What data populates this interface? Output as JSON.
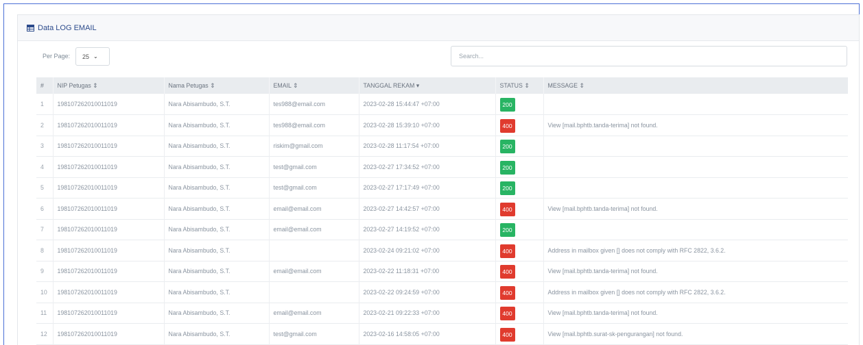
{
  "card": {
    "title": "Data LOG EMAIL",
    "title_icon": "table-icon",
    "accent": "#2b4a8b"
  },
  "controls": {
    "per_page_label": "Per Page:",
    "per_page_value": "25",
    "search_placeholder": "Search..."
  },
  "table": {
    "columns": [
      "#",
      "NIP Petugas ⇕",
      "Nama Petugas ⇕",
      "EMAIL ⇕",
      "TANGGAL REKAM ▾",
      "STATUS ⇕",
      "MESSAGE ⇕"
    ],
    "status_colors": {
      "200": "#28b463",
      "400": "#e03b2e"
    },
    "rows": [
      {
        "no": "1",
        "nip": "198107262010011019",
        "nama": "Nara Abisambudo, S.T.",
        "email": "tes988@email.com",
        "tanggal": "2023-02-28 15:44:47 +07:00",
        "status": "200",
        "message": ""
      },
      {
        "no": "2",
        "nip": "198107262010011019",
        "nama": "Nara Abisambudo, S.T.",
        "email": "tes988@email.com",
        "tanggal": "2023-02-28 15:39:10 +07:00",
        "status": "400",
        "message": "View [mail.bphtb.tanda-terima] not found."
      },
      {
        "no": "3",
        "nip": "198107262010011019",
        "nama": "Nara Abisambudo, S.T.",
        "email": "riskim@gmail.com",
        "tanggal": "2023-02-28 11:17:54 +07:00",
        "status": "200",
        "message": ""
      },
      {
        "no": "4",
        "nip": "198107262010011019",
        "nama": "Nara Abisambudo, S.T.",
        "email": "test@gmail.com",
        "tanggal": "2023-02-27 17:34:52 +07:00",
        "status": "200",
        "message": ""
      },
      {
        "no": "5",
        "nip": "198107262010011019",
        "nama": "Nara Abisambudo, S.T.",
        "email": "test@gmail.com",
        "tanggal": "2023-02-27 17:17:49 +07:00",
        "status": "200",
        "message": ""
      },
      {
        "no": "6",
        "nip": "198107262010011019",
        "nama": "Nara Abisambudo, S.T.",
        "email": "email@email.com",
        "tanggal": "2023-02-27 14:42:57 +07:00",
        "status": "400",
        "message": "View [mail.bphtb.tanda-terima] not found."
      },
      {
        "no": "7",
        "nip": "198107262010011019",
        "nama": "Nara Abisambudo, S.T.",
        "email": "email@email.com",
        "tanggal": "2023-02-27 14:19:52 +07:00",
        "status": "200",
        "message": ""
      },
      {
        "no": "8",
        "nip": "198107262010011019",
        "nama": "Nara Abisambudo, S.T.",
        "email": "",
        "tanggal": "2023-02-24 09:21:02 +07:00",
        "status": "400",
        "message": "Address in mailbox given [] does not comply with RFC 2822, 3.6.2."
      },
      {
        "no": "9",
        "nip": "198107262010011019",
        "nama": "Nara Abisambudo, S.T.",
        "email": "email@email.com",
        "tanggal": "2023-02-22 11:18:31 +07:00",
        "status": "400",
        "message": "View [mail.bphtb.tanda-terima] not found."
      },
      {
        "no": "10",
        "nip": "198107262010011019",
        "nama": "Nara Abisambudo, S.T.",
        "email": "",
        "tanggal": "2023-02-22 09:24:59 +07:00",
        "status": "400",
        "message": "Address in mailbox given [] does not comply with RFC 2822, 3.6.2."
      },
      {
        "no": "11",
        "nip": "198107262010011019",
        "nama": "Nara Abisambudo, S.T.",
        "email": "email@email.com",
        "tanggal": "2023-02-21 09:22:33 +07:00",
        "status": "400",
        "message": "View [mail.bphtb.tanda-terima] not found."
      },
      {
        "no": "12",
        "nip": "198107262010011019",
        "nama": "Nara Abisambudo, S.T.",
        "email": "test@gmail.com",
        "tanggal": "2023-02-16 14:58:05 +07:00",
        "status": "400",
        "message": "View [mail.bphtb.surat-sk-pengurangan] not found."
      }
    ]
  }
}
